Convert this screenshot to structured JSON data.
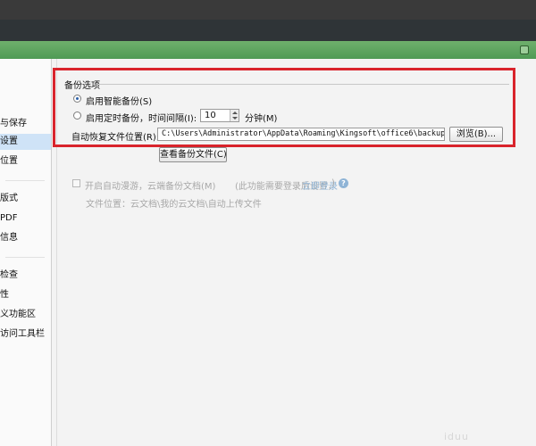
{
  "sidebar": {
    "items": [
      {
        "label": "与保存",
        "selected": false
      },
      {
        "label": "设置",
        "selected": true
      },
      {
        "label": "位置",
        "selected": false
      },
      {
        "label": "版式",
        "selected": false
      },
      {
        "label": "PDF",
        "selected": false
      },
      {
        "label": "信息",
        "selected": false
      },
      {
        "label": "检查",
        "selected": false
      },
      {
        "label": "性",
        "selected": false
      },
      {
        "label": "义功能区",
        "selected": false
      },
      {
        "label": "访问工具栏",
        "selected": false
      }
    ]
  },
  "backup": {
    "group_title": "备份选项",
    "smart_backup_label": "启用智能备份(S)",
    "timed_backup_label": "启用定时备份，时间间隔(I):",
    "interval_value": "10",
    "interval_unit": "分钟(M)",
    "recovery_location_label": "自动恢复文件位置(R):",
    "recovery_path": "C:\\Users\\Administrator\\AppData\\Roaming\\Kingsoft\\office6\\backup",
    "browse_button": "浏览(B)...",
    "view_backup_button": "查看备份文件(C)",
    "selected_option": "smart_backup"
  },
  "cloud": {
    "roaming_label": "开启自动漫游，云端备份文档(M)",
    "roaming_note": "(此功能需要登录后设置，",
    "login_link": "立即登录",
    "close_paren": ")",
    "file_location": "文件位置：云文档\\我的云文档\\自动上传文件",
    "enabled": false
  },
  "colors": {
    "highlight": "#d9242c",
    "selected_bg": "#cfe3f7",
    "green_bar": "#5aa35b",
    "link": "#8fb4d6"
  },
  "watermark": "iduu"
}
